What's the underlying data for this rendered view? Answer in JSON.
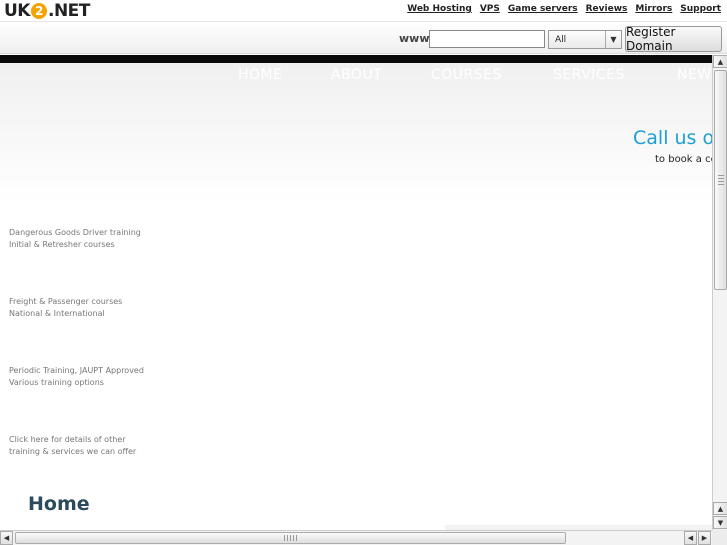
{
  "logo": {
    "text_a": "UK",
    "text_b": "2",
    "text_c": ".NET"
  },
  "top_links": [
    "Web Hosting",
    "VPS",
    "Game servers",
    "Reviews",
    "Mirrors",
    "Support"
  ],
  "domain_search": {
    "prefix_label": "www.",
    "input_value": "",
    "tld_selected": "All",
    "register_label": "Register Domain"
  },
  "nav": [
    "HOME",
    "ABOUT",
    "COURSES",
    "SERVICES",
    "NEWS"
  ],
  "contact": {
    "headline": "Call us on",
    "subline": "to book a course"
  },
  "features": [
    {
      "line1": "Dangerous Goods Driver training",
      "line2": "Initial & Retresher courses"
    },
    {
      "line1": "Freight & Passenger courses",
      "line2": "National & International"
    },
    {
      "line1": "Periodic Training, JAUPT Approved",
      "line2": "Various training options"
    },
    {
      "line1": "Click here for details of other",
      "line2": "training & services we can offer"
    }
  ],
  "page_heading": "Home",
  "colors": {
    "accent": "#1e9fd4",
    "heading": "#2b4a5c",
    "logo_badge": "#f5a300"
  }
}
